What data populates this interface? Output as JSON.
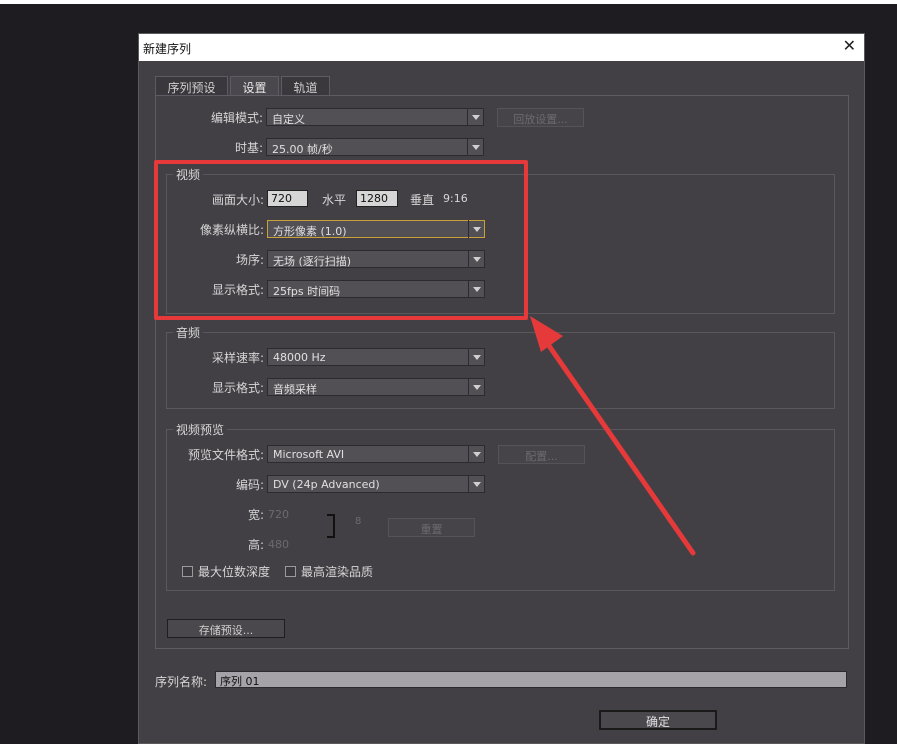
{
  "dialog": {
    "title": "新建序列",
    "close_icon": "close-icon"
  },
  "tabs": [
    {
      "label": "序列预设"
    },
    {
      "label": "设置"
    },
    {
      "label": "轨道"
    }
  ],
  "general": {
    "edit_mode_label": "编辑模式:",
    "edit_mode_value": "自定义",
    "playback_settings_label": "回放设置...",
    "timebase_label": "时基:",
    "timebase_value": "25.00 帧/秒"
  },
  "video": {
    "group_title": "视频",
    "frame_size_label": "画面大小:",
    "frame_width": "720",
    "horizontal_label": "水平",
    "frame_height": "1280",
    "vertical_label": "垂直",
    "aspect_text": "9:16",
    "pixel_aspect_label": "像素纵横比:",
    "pixel_aspect_value": "方形像素 (1.0)",
    "fields_label": "场序:",
    "fields_value": "无场 (逐行扫描)",
    "display_format_label": "显示格式:",
    "display_format_value": "25fps 时间码"
  },
  "audio": {
    "group_title": "音频",
    "sample_rate_label": "采样速率:",
    "sample_rate_value": "48000 Hz",
    "display_format_label": "显示格式:",
    "display_format_value": "音频采样"
  },
  "video_preview": {
    "group_title": "视频预览",
    "file_format_label": "预览文件格式:",
    "file_format_value": "Microsoft AVI",
    "configure_label": "配置...",
    "codec_label": "编码:",
    "codec_value": "DV (24p Advanced)",
    "width_label": "宽:",
    "width_value": "720",
    "height_label": "高:",
    "height_value": "480",
    "reset_label": "重置",
    "max_bit_depth_label": "最大位数深度",
    "max_render_quality_label": "最高渲染品质"
  },
  "save_preset_label": "存储预设...",
  "sequence_name_label": "序列名称:",
  "sequence_name_value": "序列 01",
  "ok_label": "确定",
  "colors": {
    "annotation": "#e5393a",
    "dialog_bg": "#424045"
  }
}
